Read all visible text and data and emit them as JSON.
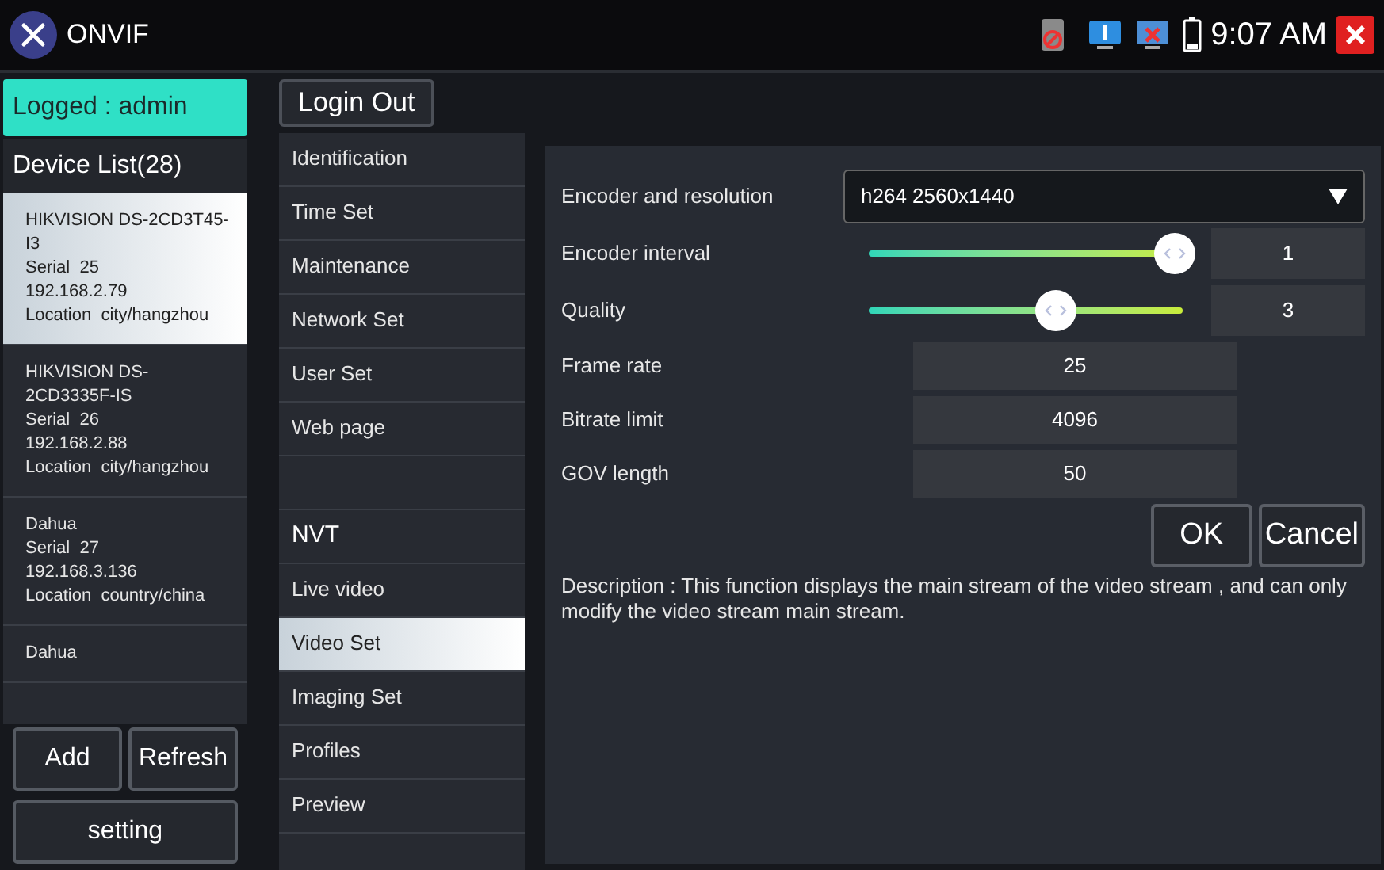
{
  "app": {
    "title": "ONVIF",
    "time": "9:07 AM"
  },
  "login": {
    "status": "Logged : admin",
    "logout_button": "Login Out"
  },
  "device_list": {
    "title": "Device List(28)",
    "devices": [
      {
        "lines": [
          "HIKVISION DS-2CD3T45-I3",
          "Serial  25",
          "192.168.2.79",
          "Location  city/hangzhou"
        ],
        "selected": true
      },
      {
        "lines": [
          "HIKVISION DS-2CD3335F-IS",
          "Serial  26",
          "192.168.2.88",
          "Location  city/hangzhou"
        ],
        "selected": false
      },
      {
        "lines": [
          "Dahua",
          "Serial  27",
          "192.168.3.136",
          "Location  country/china"
        ],
        "selected": false
      },
      {
        "lines": [
          "Dahua"
        ],
        "selected": false
      }
    ],
    "buttons": [
      "Add",
      "Refresh"
    ],
    "setting_button": "setting"
  },
  "menu": [
    {
      "kind": "item",
      "label": "Identification",
      "selected": false
    },
    {
      "kind": "item",
      "label": "Time Set",
      "selected": false
    },
    {
      "kind": "item",
      "label": "Maintenance",
      "selected": false
    },
    {
      "kind": "item",
      "label": "Network Set",
      "selected": false
    },
    {
      "kind": "item",
      "label": "User Set",
      "selected": false
    },
    {
      "kind": "item",
      "label": "Web page",
      "selected": false
    },
    {
      "kind": "blank"
    },
    {
      "kind": "header",
      "label": "NVT"
    },
    {
      "kind": "item",
      "label": "Live video",
      "selected": false
    },
    {
      "kind": "item",
      "label": "Video Set",
      "selected": true
    },
    {
      "kind": "item",
      "label": "Imaging Set",
      "selected": false
    },
    {
      "kind": "item",
      "label": "Profiles",
      "selected": false
    },
    {
      "kind": "item",
      "label": "Preview",
      "selected": false
    },
    {
      "kind": "blank"
    }
  ],
  "settings": [
    {
      "kind": "dropdown",
      "label": "Encoder and resolution",
      "value": "h264 2560x1440"
    },
    {
      "kind": "slider",
      "label": "Encoder interval",
      "level": 1,
      "value": "1"
    },
    {
      "kind": "slider",
      "label": "Quality",
      "level": 0.6,
      "value": "3"
    },
    {
      "kind": "field",
      "label": "Frame rate",
      "value": "25"
    },
    {
      "kind": "field",
      "label": "Bitrate limit",
      "value": "4096"
    },
    {
      "kind": "field",
      "label": "GOV length",
      "value": "50"
    }
  ],
  "actions": [
    "OK",
    "Cancel"
  ],
  "description": "Description : This function displays the main stream of the video stream , and can only modify the video stream main stream."
}
